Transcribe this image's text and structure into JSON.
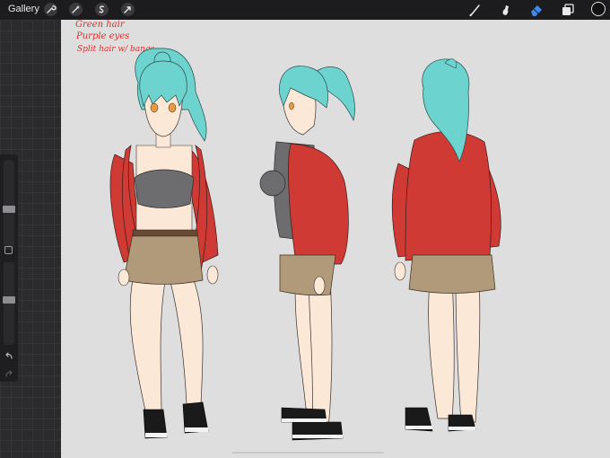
{
  "app": {
    "gallery_label": "Gallery"
  },
  "toolbar_left": {
    "actions_icon": "wrench-icon",
    "adjustments_icon": "magic-wand-icon",
    "selection_icon": "selection-s-icon",
    "transform_icon": "arrow-cursor-icon"
  },
  "toolbar_right": {
    "brush_icon": "brush-icon",
    "smudge_icon": "smudge-icon",
    "eraser_icon": "eraser-icon",
    "layers_icon": "layers-icon",
    "color_icon": "color-swatch",
    "active_tool": "eraser",
    "active_color": "#111111"
  },
  "sidebar": {
    "size_slider_level": 0.45,
    "opacity_slider_level": 0.55,
    "undo_icon": "undo-icon",
    "redo_icon": "redo-icon",
    "modify_icon": "square-icon"
  },
  "canvas": {
    "notes": [
      "Green hair",
      "Purple eyes",
      "Split hair w/ bangs"
    ],
    "note_color": "#d6302a",
    "palette": {
      "hair": "#6cd3cf",
      "jacket": "#cf3a34",
      "skirt": "#b19a7a",
      "top": "#6d6d6f",
      "skin": "#fbe8d6",
      "shoe": "#1a1a1a"
    },
    "figures": [
      "front-view",
      "side-view",
      "back-view"
    ]
  }
}
